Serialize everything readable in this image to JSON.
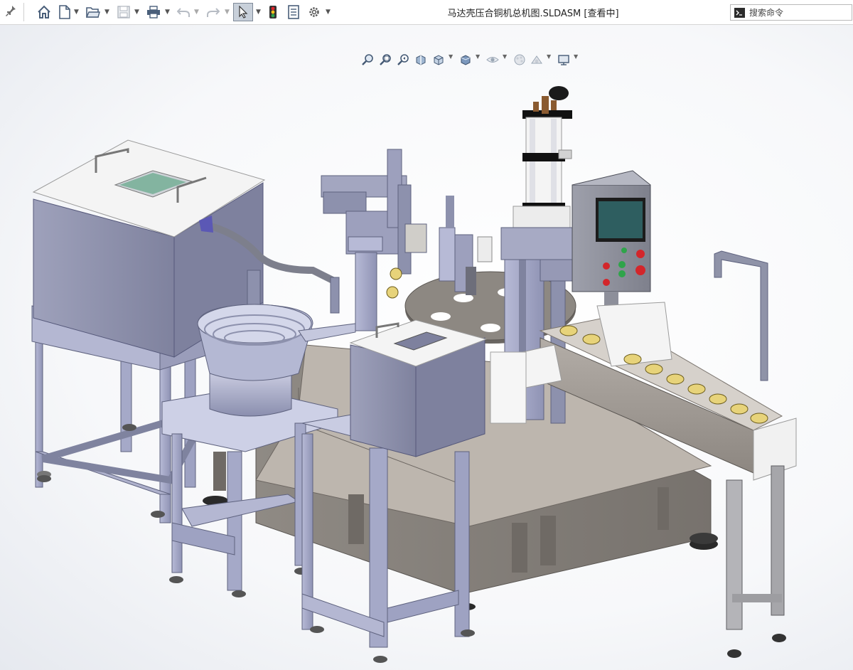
{
  "window": {
    "title": "马达壳压合铜机总机图.SLDASM [查看中]"
  },
  "toolbar": {
    "items": [
      {
        "name": "home-icon"
      },
      {
        "name": "new-document-icon"
      },
      {
        "name": "open-folder-icon"
      },
      {
        "name": "save-icon"
      },
      {
        "name": "print-icon"
      },
      {
        "name": "undo-icon"
      },
      {
        "name": "redo-icon"
      },
      {
        "name": "select-pointer-icon"
      },
      {
        "name": "rebuild-traffic-light-icon"
      },
      {
        "name": "file-properties-icon"
      },
      {
        "name": "options-gear-icon"
      }
    ]
  },
  "search": {
    "placeholder": "搜索命令"
  },
  "heads_up_toolbar": {
    "items": [
      {
        "name": "zoom-to-fit-icon"
      },
      {
        "name": "zoom-to-area-icon"
      },
      {
        "name": "previous-view-icon"
      },
      {
        "name": "section-view-icon"
      },
      {
        "name": "view-orientation-icon"
      },
      {
        "name": "display-style-icon"
      },
      {
        "name": "hide-show-items-icon"
      },
      {
        "name": "edit-appearance-icon"
      },
      {
        "name": "apply-scene-icon"
      },
      {
        "name": "view-settings-icon"
      }
    ]
  },
  "colors": {
    "frame": "#a9accb",
    "frame_dark": "#8d91b3",
    "base_cabinet": "#8a8580",
    "top_plate": "#c9c2bb",
    "hopper_box": "#8e91ad",
    "white_lid": "#f3f3f3",
    "panel_screen": "#2e5e60",
    "button_red": "#d3262b",
    "button_green": "#2fa44a"
  }
}
